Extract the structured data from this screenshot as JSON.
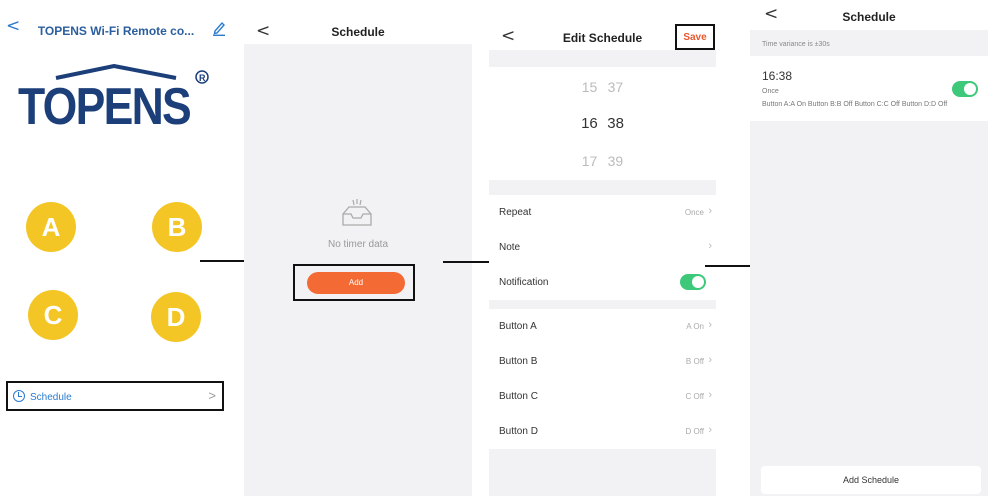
{
  "screen1": {
    "back_glyph": "<",
    "title": "TOPENS Wi-Fi Remote co...",
    "edit_icon": "pencil-icon",
    "logo_text": "TOPENS",
    "buttons": [
      "A",
      "B",
      "C",
      "D"
    ],
    "schedule_label": "Schedule",
    "chevron": ">"
  },
  "screen2": {
    "back_glyph": "<",
    "title": "Schedule",
    "empty_text": "No timer data",
    "add_label": "Add"
  },
  "screen3": {
    "back_glyph": "<",
    "title": "Edit Schedule",
    "save_label": "Save",
    "picker": {
      "above": [
        "15",
        "37"
      ],
      "selected": [
        "16",
        "38"
      ],
      "below": [
        "17",
        "39"
      ]
    },
    "settings": [
      {
        "label": "Repeat",
        "value": "Once"
      },
      {
        "label": "Note",
        "value": ""
      },
      {
        "label": "Notification",
        "toggle": true
      }
    ],
    "buttons": [
      {
        "label": "Button A",
        "value": "A On"
      },
      {
        "label": "Button B",
        "value": "B Off"
      },
      {
        "label": "Button C",
        "value": "C Off"
      },
      {
        "label": "Button D",
        "value": "D Off"
      }
    ]
  },
  "screen4": {
    "back_glyph": "<",
    "title": "Schedule",
    "variance": "Time variance is ±30s",
    "entry": {
      "time": "16:38",
      "repeat": "Once",
      "actions": "Button A:A On  Button B:B Off  Button C:C Off  Button D:D Off",
      "enabled": true
    },
    "add_schedule_label": "Add Schedule"
  },
  "colors": {
    "accent_orange": "#f46a35",
    "save_red": "#e9572e",
    "toggle_green": "#3ec97a",
    "circle_yellow": "#f3c626",
    "link_blue": "#2b7bd0",
    "logo_navy": "#1c3f7a"
  }
}
